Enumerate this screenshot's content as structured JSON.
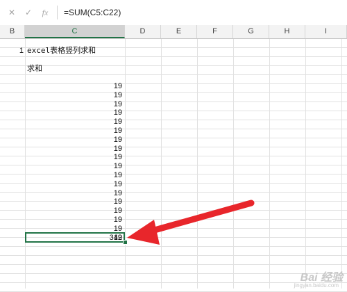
{
  "formula_bar": {
    "cancel_icon": "close-icon",
    "enter_icon": "check-icon",
    "fx_label": "fx",
    "formula": "=SUM(C5:C22)"
  },
  "columns": [
    "B",
    "C",
    "D",
    "E",
    "F",
    "G",
    "H",
    "I"
  ],
  "selected_column": "C",
  "cells": {
    "row_number": "1",
    "title": "excel表格竖列求和",
    "header": "求和",
    "values": [
      "19",
      "19",
      "19",
      "19",
      "19",
      "19",
      "19",
      "19",
      "19",
      "19",
      "19",
      "19",
      "19",
      "19",
      "19",
      "19",
      "19",
      "19"
    ],
    "sum": "342"
  },
  "watermark": {
    "text": "Bai 经验",
    "sub": "jingyan.baidu.com"
  },
  "colors": {
    "accent": "#217346",
    "arrow": "#e8262b"
  }
}
